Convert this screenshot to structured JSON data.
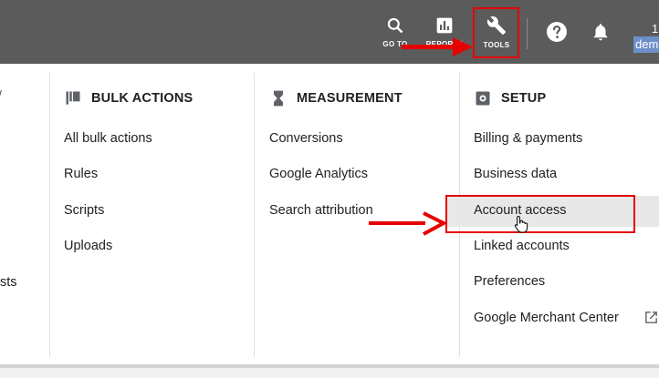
{
  "topbar": {
    "goto_label": "GO TO",
    "reports_label": "REPORTS",
    "tools_label": "TOOLS",
    "account_number": "1",
    "account_name": "demo"
  },
  "left_fragment": {
    "header_mark": "/",
    "item_suffix": "sts"
  },
  "bulk_actions": {
    "title": "BULK ACTIONS",
    "items": [
      "All bulk actions",
      "Rules",
      "Scripts",
      "Uploads"
    ]
  },
  "measurement": {
    "title": "MEASUREMENT",
    "items": [
      "Conversions",
      "Google Analytics",
      "Search attribution"
    ]
  },
  "setup": {
    "title": "SETUP",
    "items": [
      "Billing & payments",
      "Business data",
      "Account access",
      "Linked accounts",
      "Preferences",
      "Google Merchant Center"
    ]
  },
  "colors": {
    "topbar": "#5b5b5b",
    "annotation_red": "#e60000",
    "highlight_row": "#e8e8e8"
  }
}
